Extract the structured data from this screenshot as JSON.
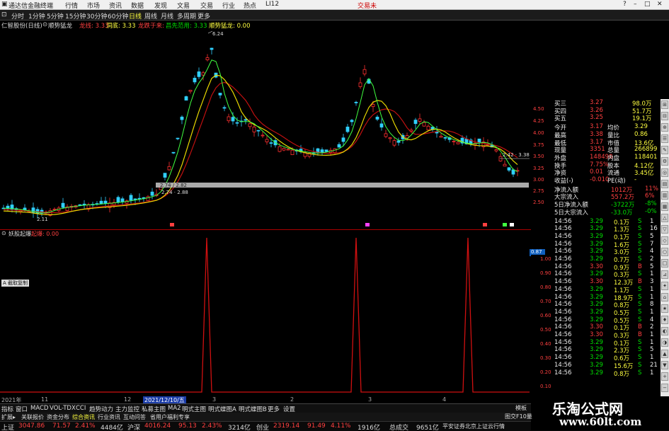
{
  "colors": {
    "up": "#ff3030",
    "down": "#30d0ff",
    "ma_fast": "#ffffff",
    "ma_mid": "#ffff00",
    "ma_slow": "#d01010",
    "grid": "#800000"
  },
  "titlebar": {
    "app_name": "通达信金融终端",
    "menus": [
      "行情",
      "市场",
      "资讯",
      "数据",
      "发现",
      "文易",
      "交易",
      "行业",
      "热点",
      "LI12"
    ],
    "right": "交易未"
  },
  "toolbar": {
    "periods": [
      "分时",
      "1分钟",
      "5分钟",
      "15分钟",
      "30分钟",
      "60分钟",
      "日线",
      "周线",
      "月线",
      "多周期",
      "更多"
    ]
  },
  "info_line": {
    "stock": "仁智股份(日线)",
    "indicator": "顺势猛龙",
    "items": [
      "龙线: 3.33",
      "洞底: 3.33",
      "龙跌于来:",
      "昌先范用: 3.33",
      "顺势猛龙: 0.00"
    ]
  },
  "chart_labels": {
    "peak_label": "6.24",
    "low_label": "2.11",
    "band_top_label": "2.74 / 2.82",
    "band_bottom_label": "2.74 · 2.88",
    "right_annotation": "2.42 · 3.38",
    "sub_right_value": "0.87"
  },
  "y_axis_main": [
    "4.50",
    "4.25",
    "4.00",
    "3.75",
    "3.50",
    "3.25",
    "3.00",
    "2.75",
    "2.50"
  ],
  "y_axis_sub": [
    "1.00",
    "0.90",
    "0.80",
    "0.70",
    "0.60",
    "0.50",
    "0.40",
    "0.30",
    "0.20",
    "0.10"
  ],
  "sub_header": {
    "name": "妖股起爆",
    "value": "起爆: 0.00"
  },
  "sub_tag": "A 截取复制",
  "timeline": {
    "labels": [
      "2021年",
      "11",
      "12",
      "2021/12/10/五",
      "3",
      "2",
      "3",
      "4"
    ]
  },
  "bottom_tabs": [
    "指标",
    "窗口",
    "MACD",
    "VOL-TDX",
    "CCI",
    "趋势动力",
    "主力监控",
    "私募主图",
    "MA2",
    "明式主图",
    "明式蝶图A",
    "明式蝶图B",
    "更多",
    "设置"
  ],
  "bottom_tabs2": [
    "扩展▸",
    "关联报价",
    "资金分布",
    "综合资讯",
    "行业资讯",
    "互动问答",
    "省用户福利专享"
  ],
  "right_panel": {
    "top_rows": [
      {
        "label": "买三",
        "price": "3.27",
        "vol": "98.0万"
      },
      {
        "label": "买四",
        "price": "3.26",
        "vol": "51.7万"
      },
      {
        "label": "买五",
        "price": "3.25",
        "vol": "19.1万"
      }
    ],
    "stats": [
      {
        "l": "今开",
        "v": "3.17",
        "l2": "均价",
        "v2": "3.29"
      },
      {
        "l": "最高",
        "v": "3.38",
        "l2": "量比",
        "v2": "0.86"
      },
      {
        "l": "最低",
        "v": "3.17",
        "l2": "市值",
        "v2": "13.6亿"
      },
      {
        "l": "现量",
        "v": "3351",
        "l2": "总量",
        "v2": "266899"
      },
      {
        "l": "外盘",
        "v": "148498",
        "l2": "内盘",
        "v2": "118401"
      },
      {
        "l": "换手",
        "v": "7.75%",
        "l2": "股本",
        "v2": "4.12亿"
      },
      {
        "l": "净资",
        "v": "0.01",
        "l2": "流通",
        "v2": "3.45亿"
      },
      {
        "l": "收益(-)",
        "v": "-0.010",
        "l2": "PE(动)",
        "v2": "-"
      }
    ],
    "flows": [
      {
        "label": "净流入额",
        "value": "1012万",
        "pct": "11%"
      },
      {
        "label": "大宗流入",
        "value": "557.2万",
        "pct": "6%"
      },
      {
        "label": "5日净流入额",
        "value": "-3722万",
        "pct": "-8%"
      },
      {
        "label": "5日大宗流入",
        "value": "-33.0万",
        "pct": "-0%"
      }
    ],
    "ticks": [
      {
        "t": "14:56",
        "p": "3.29",
        "v": "0.1万",
        "d": "S"
      },
      {
        "t": "14:56",
        "p": "3.29",
        "v": "1.3万",
        "d": "S"
      },
      {
        "t": "14:56",
        "p": "3.29",
        "v": "0.1万",
        "d": "S"
      },
      {
        "t": "14:56",
        "p": "3.29",
        "v": "1.6万",
        "d": "S"
      },
      {
        "t": "14:56",
        "p": "3.29",
        "v": "3.0万",
        "d": "S"
      },
      {
        "t": "14:56",
        "p": "3.29",
        "v": "0.7万",
        "d": "S"
      },
      {
        "t": "14:56",
        "p": "3.30",
        "v": "0.9万",
        "d": "B"
      },
      {
        "t": "14:56",
        "p": "3.29",
        "v": "0.3万",
        "d": "S"
      },
      {
        "t": "14:56",
        "p": "3.30",
        "v": "12.3万",
        "d": "B"
      },
      {
        "t": "14:56",
        "p": "3.29",
        "v": "1.1万",
        "d": "S"
      },
      {
        "t": "14:56",
        "p": "3.29",
        "v": "18.9万",
        "d": "S"
      },
      {
        "t": "14:56",
        "p": "3.29",
        "v": "0.8万",
        "d": "S"
      },
      {
        "t": "14:56",
        "p": "3.29",
        "v": "0.5万",
        "d": "S"
      },
      {
        "t": "14:56",
        "p": "3.29",
        "v": "0.5万",
        "d": "S"
      },
      {
        "t": "14:56",
        "p": "3.30",
        "v": "0.1万",
        "d": "B"
      },
      {
        "t": "14:56",
        "p": "3.30",
        "v": "0.3万",
        "d": "B"
      },
      {
        "t": "14:56",
        "p": "3.29",
        "v": "0.1万",
        "d": "S"
      },
      {
        "t": "14:56",
        "p": "3.29",
        "v": "2.3万",
        "d": "S"
      },
      {
        "t": "14:56",
        "p": "3.29",
        "v": "0.6万",
        "d": "S"
      },
      {
        "t": "14:56",
        "p": "3.29",
        "v": "15.6万",
        "d": "S"
      },
      {
        "t": "14:56",
        "p": "3.29",
        "v": "0.8万",
        "d": "S"
      }
    ],
    "tick_counts": [
      "1",
      "16",
      "5",
      "7",
      "4",
      "2",
      "5",
      "1",
      "3",
      "1",
      "1",
      "8",
      "1",
      "4",
      "2",
      "1",
      "1",
      "5",
      "1",
      "21",
      "1"
    ],
    "tabs_bottom": [
      "图交F10量",
      "模板"
    ]
  },
  "statusbar": {
    "items": [
      {
        "label": "上证",
        "v1": "3047.86",
        "v2": "71.57",
        "v3": "2.41%",
        "v4": "4484亿"
      },
      {
        "label": "沪深",
        "v1": "4016.24",
        "v2": "95.13",
        "v3": "2.43%",
        "v4": "3214亿"
      },
      {
        "label": "创业",
        "v1": "2319.14",
        "v2": "91.49",
        "v3": "4.11%",
        "v4": "1916亿"
      }
    ],
    "total_label": "总成交",
    "total_value": "9651亿",
    "broker": "平安证券北京上证云行情"
  },
  "watermark": {
    "title": "乐淘公式网",
    "url": "www.60lt.com"
  }
}
